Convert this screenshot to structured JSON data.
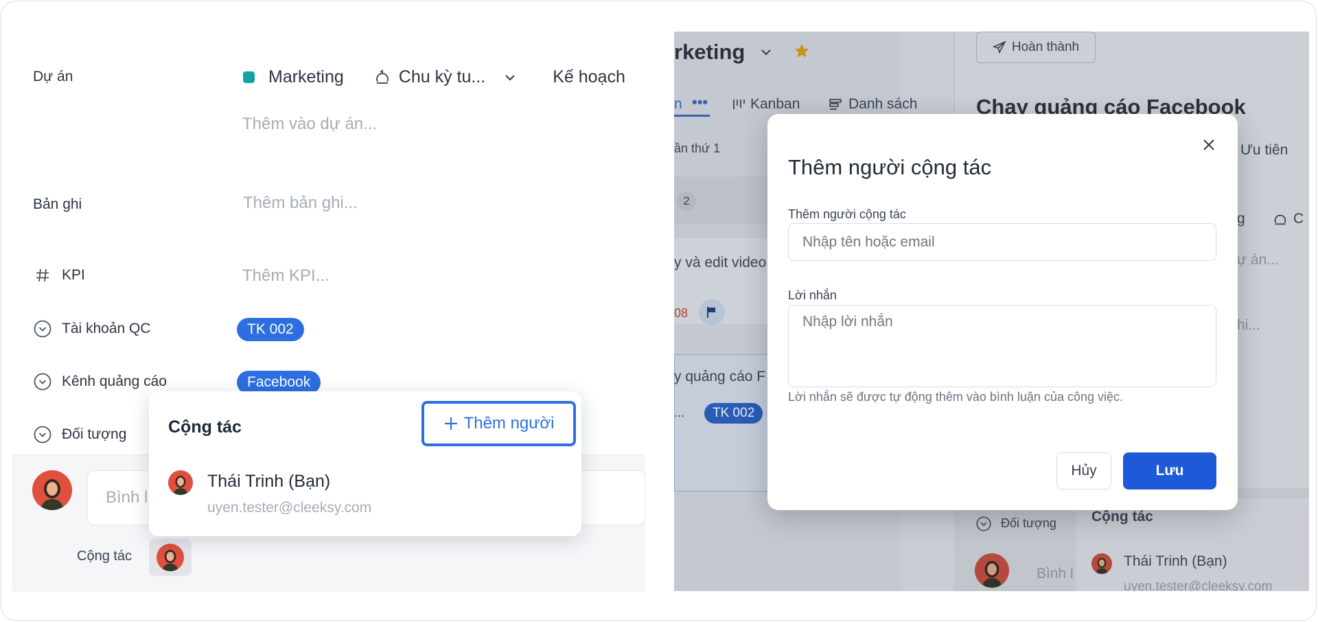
{
  "left": {
    "fields": {
      "project_label": "Dự án",
      "project_name": "Marketing",
      "cycle": "Chu kỳ tu...",
      "plan": "Kế hoạch",
      "add_project": "Thêm vào dự án...",
      "notes_label": "Bản ghi",
      "notes_placeholder": "Thêm bản ghi...",
      "kpi_label": "KPI",
      "kpi_placeholder": "Thêm KPI...",
      "ad_account_label": "Tài khoản QC",
      "ad_account_value": "TK 002",
      "channel_label": "Kênh quảng cáo",
      "channel_value": "Facebook",
      "audience_label": "Đối tượng"
    },
    "composer": {
      "comment_placeholder": "Bình l",
      "collab_label": "Cộng tác"
    },
    "popover": {
      "title": "Cộng tác",
      "add_button": "Thêm người",
      "user_name": "Thái Trinh (Bạn)",
      "user_email": "uyen.tester@cleeksy.com"
    }
  },
  "right_bg": {
    "project_title": "rketing",
    "done_button": "Hoàn thành",
    "view_active": "n",
    "view_kanban": "Kanban",
    "view_list": "Danh sách",
    "task_title": "Chạy quảng cáo Facebook",
    "filter": "ần thứ 1",
    "priority": "Ưu tiên",
    "count": "2",
    "card1": "y và edit video",
    "card1_date": "08",
    "card2": "y quảng cáo F",
    "card2_pill": "TK 002",
    "card2_dots": "...",
    "audience": "Đối tượng",
    "collab_title": "Cộng tác",
    "collab_name": "Thái Trinh (Bạn)",
    "collab_email": "uyen.tester@cleeksy.com",
    "comment_stub": "Bình l",
    "side_g": "g",
    "side_c": "C",
    "side_proj": "ự án...",
    "side_notes": "hi..."
  },
  "modal": {
    "title": "Thêm người cộng tác",
    "collab_label": "Thêm người cộng tác",
    "collab_placeholder": "Nhập tên hoặc email",
    "message_label": "Lời nhắn",
    "message_placeholder": "Nhập lời nhắn",
    "help_text": "Lời nhắn sẽ được tự động thêm vào bình luận của công việc.",
    "cancel": "Hủy",
    "save": "Lưu"
  },
  "colors": {
    "accent": "#2d6fe0",
    "project_dot": "#13a3a3",
    "save_button": "#1e5ad8"
  }
}
